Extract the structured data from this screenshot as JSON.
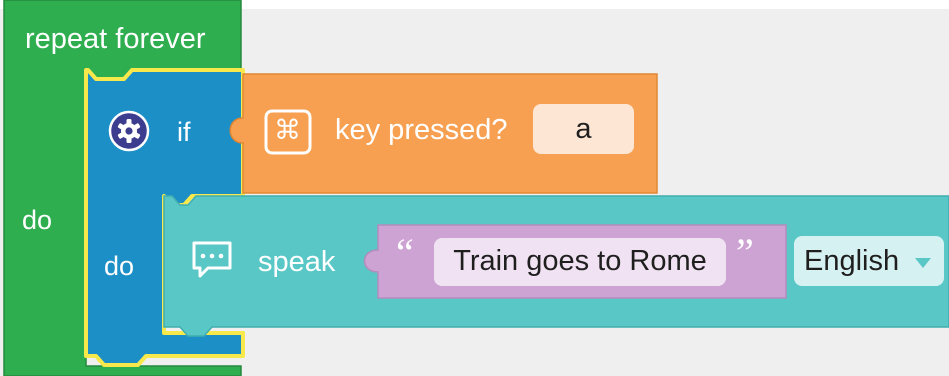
{
  "blocks": {
    "repeat_forever": {
      "header_label": "repeat forever",
      "do_label": "do",
      "color": "#2fae4f",
      "highlight_color": "#f7e84c"
    },
    "if_block": {
      "label": "if",
      "do_label": "do",
      "color": "#1d8fc7",
      "icon": "gear-icon"
    },
    "key_pressed": {
      "label": "key pressed?",
      "key_value": "a",
      "color": "#f7a051",
      "icon": "command-key-icon"
    },
    "speak": {
      "label": "speak",
      "text_value": "Train goes to Rome",
      "open_quote": "“",
      "close_quote": "”",
      "language": "English",
      "color": "#58c7c6",
      "string_color": "#cda3d4",
      "icon": "speech-bubble-icon",
      "dropdown_icon": "caret-down-icon"
    }
  }
}
